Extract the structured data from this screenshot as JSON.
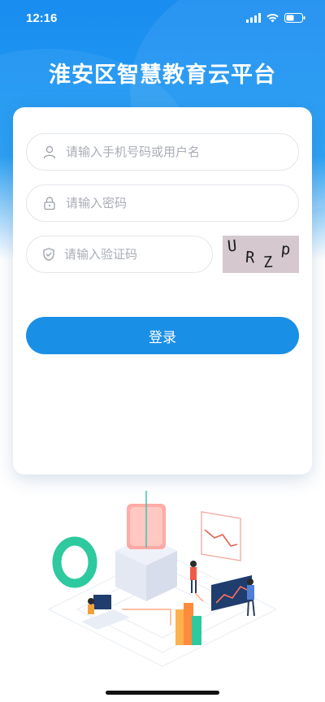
{
  "status_bar": {
    "time": "12:16",
    "icons": [
      "signal-icon",
      "wifi-icon",
      "battery-icon"
    ]
  },
  "header": {
    "title": "淮安区智慧教育云平台"
  },
  "login_form": {
    "username": {
      "placeholder": "请输入手机号码或用户名",
      "value": "",
      "icon": "user-icon"
    },
    "password": {
      "placeholder": "请输入密码",
      "value": "",
      "icon": "lock-icon"
    },
    "captcha_input": {
      "placeholder": "请输入验证码",
      "value": "",
      "icon": "shield-icon"
    },
    "captcha_image": {
      "chars": [
        "U",
        "R",
        "Z",
        "p"
      ]
    },
    "login_label": "登录"
  },
  "colors": {
    "primary": "#1a8fe6",
    "header_bg": "#1a8df0",
    "placeholder": "#a9adb5",
    "captcha_bg": "#d5c8cf"
  }
}
